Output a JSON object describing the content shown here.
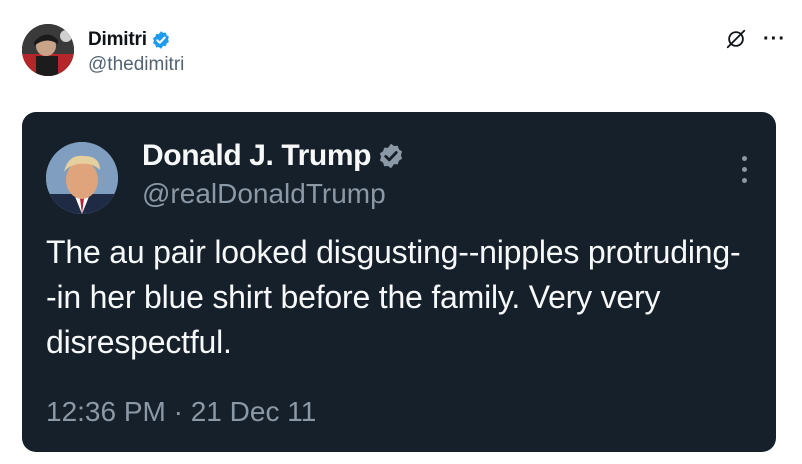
{
  "post": {
    "author_name": "Dimitri",
    "author_handle": "@thedimitri",
    "icons": {
      "verified": "verified-badge-icon",
      "grok": "grok-icon",
      "more": "more-horizontal-icon"
    },
    "more_glyph": "···"
  },
  "embed": {
    "author_name": "Donald J. Trump",
    "author_handle": "@realDonaldTrump",
    "text": "The au pair looked disgusting--nipples protruding--in her blue shirt before the family. Very very disrespectful.",
    "timestamp": "12:36 PM · 21 Dec 11",
    "icons": {
      "verified": "verified-badge-icon",
      "more": "more-vertical-icon"
    }
  },
  "colors": {
    "verified_blue": "#1d9bf0",
    "verified_gray": "#8b98a5",
    "card_background": "#15202b"
  }
}
